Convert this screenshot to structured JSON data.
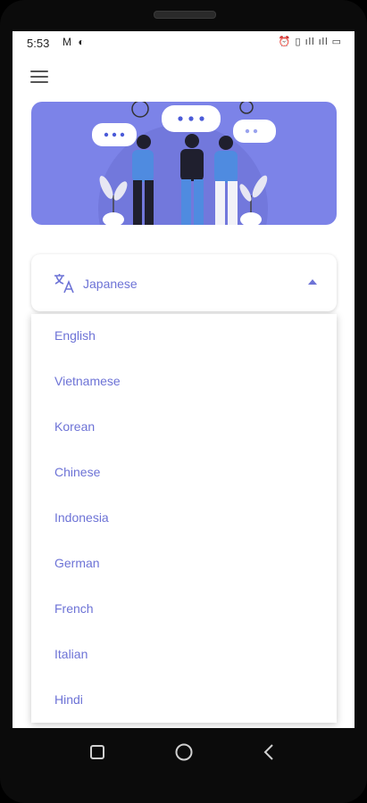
{
  "status_bar": {
    "time": "5:53",
    "left_icons": "M ◐",
    "right_icons": "⏰ ▯ ıll ıll ▭"
  },
  "header": {
    "menu_icon": "hamburger-menu-icon"
  },
  "banner": {
    "illustration": "people-chatting-illustration",
    "background": "#7c83e8"
  },
  "language_selector": {
    "icon": "translate-icon",
    "selected": "Japanese",
    "caret": "caret-up-icon",
    "accent": "#6d73d6"
  },
  "dropdown": {
    "options": [
      "English",
      "Vietnamese",
      "Korean",
      "Chinese",
      "Indonesia",
      "German",
      "French",
      "Italian",
      "Hindi"
    ]
  },
  "nav_bar": {
    "recent": "square-icon",
    "home": "circle-icon",
    "back": "chevron-left-icon"
  }
}
